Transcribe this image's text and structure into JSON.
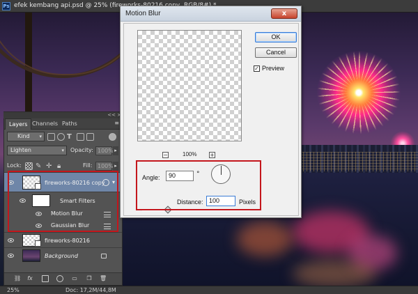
{
  "document": {
    "app_icon": "Ps",
    "title": "efek kembang api.psd @ 25% (fireworks-80216 copy, RGB/8#) *"
  },
  "canvas": {
    "content": "fireworks-over-river-photo"
  },
  "layers_panel": {
    "collapse_label": "<<",
    "close_label": "×",
    "tabs": [
      {
        "label": "Layers",
        "active": true
      },
      {
        "label": "Channels",
        "active": false
      },
      {
        "label": "Paths",
        "active": false
      }
    ],
    "menu_icon": "≡",
    "filter_kind": "Kind",
    "blend_mode": "Lighten",
    "opacity_label": "Opacity:",
    "opacity_value": "100%",
    "lock_label": "Lock:",
    "fill_label": "Fill:",
    "fill_value": "100%",
    "layers": [
      {
        "name": "fireworks-80216 copy",
        "selected": true,
        "visible": true,
        "smart_object": true
      },
      {
        "name": "Smart Filters",
        "type": "smart-filters"
      },
      {
        "name": "Motion Blur",
        "type": "filter"
      },
      {
        "name": "Gaussian Blur",
        "type": "filter"
      },
      {
        "name": "fireworks-80216",
        "visible": true
      },
      {
        "name": "Background",
        "visible": true,
        "locked": true
      }
    ],
    "footer_fx_label": "fx"
  },
  "motion_blur_dialog": {
    "title": "Motion Blur",
    "close_label": "x",
    "ok_label": "OK",
    "cancel_label": "Cancel",
    "preview_label": "Preview",
    "preview_checked": true,
    "zoom_out_label": "−",
    "zoom_in_label": "+",
    "zoom_level": "100%",
    "angle_label": "Angle:",
    "angle_value": "90",
    "angle_unit": "°",
    "distance_label": "Distance:",
    "distance_value": "100",
    "distance_unit": "Pixels",
    "distance_slider_fraction": 0.24
  },
  "status_bar": {
    "zoom": "25%",
    "doc_size": "Doc: 17,2M/44,8M"
  },
  "colors": {
    "accent_annotation": "#c4161c",
    "selection_blue": "#3a7bd5",
    "panel_bg": "#535353"
  }
}
